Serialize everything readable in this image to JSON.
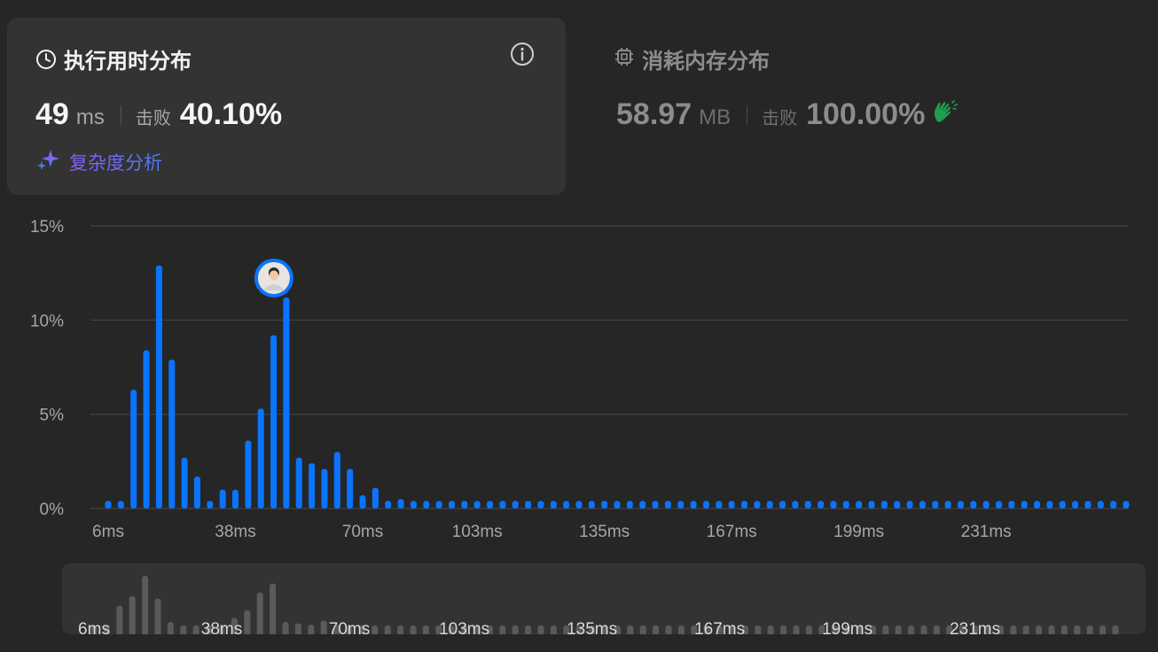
{
  "runtime_card": {
    "title": "执行用时分布",
    "value": "49",
    "unit": "ms",
    "beat_label": "击败",
    "beat_value": "40.10%",
    "analyze_label": "复杂度分析",
    "icons": {
      "clock": "clock-icon",
      "info": "info-icon",
      "sparkle": "sparkle-icon"
    }
  },
  "memory_card": {
    "title": "消耗内存分布",
    "value": "58.97",
    "unit": "MB",
    "beat_label": "击败",
    "beat_value": "100.00%",
    "icons": {
      "chip": "chip-icon",
      "clap": "clap-icon"
    }
  },
  "colors": {
    "bar": "#0a74ff",
    "mini_bar": "#5a5a5a",
    "grid": "#444444",
    "clap_green": "#1f9d4a"
  },
  "chart_data": {
    "type": "bar",
    "ylabel_ticks": [
      "0%",
      "5%",
      "10%",
      "15%"
    ],
    "y_tick_values": [
      0,
      5,
      10,
      15
    ],
    "ylim": [
      0,
      15
    ],
    "x_tick_labels": [
      "6ms",
      "38ms",
      "70ms",
      "103ms",
      "135ms",
      "167ms",
      "199ms",
      "231ms"
    ],
    "x_tick_indices": [
      0,
      10,
      20,
      29,
      39,
      49,
      59,
      69
    ],
    "values": [
      0.4,
      0.4,
      6.3,
      8.4,
      12.9,
      7.9,
      2.7,
      1.7,
      0.4,
      1.0,
      1.0,
      3.6,
      5.3,
      9.2,
      11.2,
      2.7,
      2.4,
      2.1,
      3.0,
      2.1,
      0.7,
      1.1,
      0.4,
      0.5,
      0.4,
      0.4,
      0.4,
      0.4,
      0.4,
      0.4,
      0.4,
      0.4,
      0.4,
      0.4,
      0.4,
      0.4,
      0.4,
      0.4,
      0.4,
      0.4,
      0.4,
      0.4,
      0.4,
      0.4,
      0.4,
      0.4,
      0.4,
      0.4,
      0.4,
      0.4,
      0.4,
      0.4,
      0.4,
      0.4,
      0.4,
      0.4,
      0.4,
      0.4,
      0.4,
      0.4,
      0.4,
      0.4,
      0.4,
      0.4,
      0.4,
      0.4,
      0.4,
      0.4,
      0.4,
      0.4,
      0.4,
      0.4,
      0.4,
      0.4,
      0.4,
      0.4,
      0.4,
      0.4,
      0.4,
      0.4,
      0.4
    ],
    "highlight_index": 14,
    "grid": true
  }
}
